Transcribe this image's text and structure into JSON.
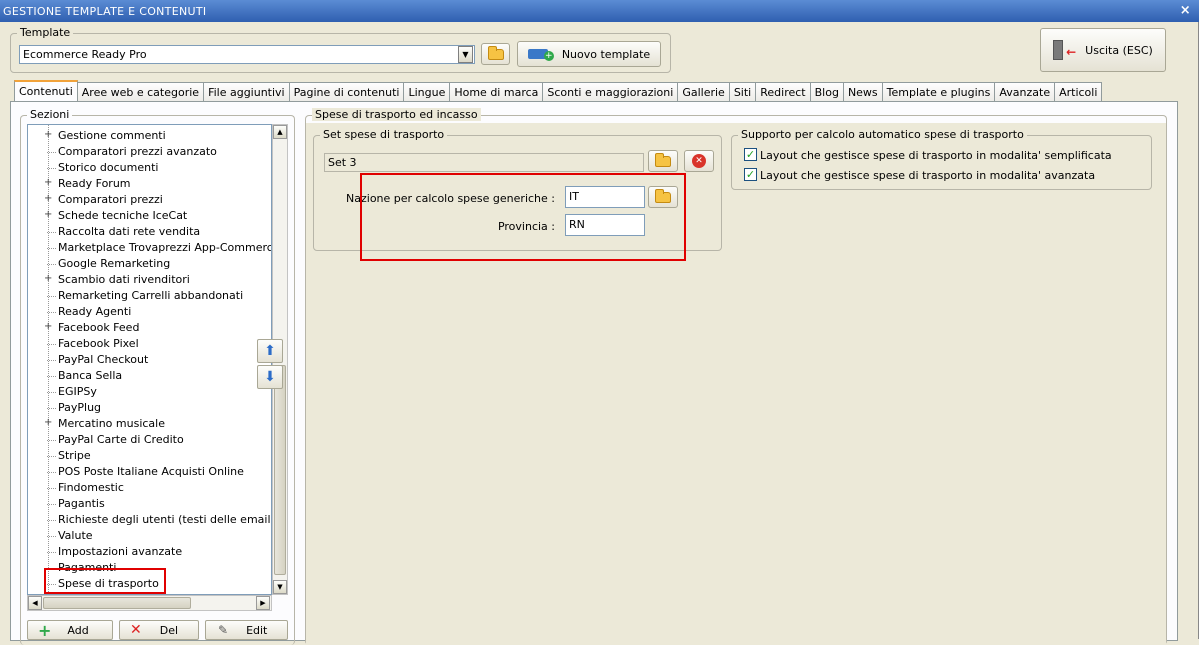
{
  "window": {
    "title": "GESTIONE TEMPLATE E CONTENUTI",
    "close_icon": "×"
  },
  "template_group": {
    "label": "Template",
    "selected": "Ecommerce Ready Pro",
    "new_button": "Nuovo template"
  },
  "exit_button": "Uscita (ESC)",
  "tabs": [
    {
      "label": "Contenuti",
      "active": true
    },
    {
      "label": "Aree web e categorie"
    },
    {
      "label": "File aggiuntivi"
    },
    {
      "label": "Pagine di contenuti"
    },
    {
      "label": "Lingue"
    },
    {
      "label": "Home di marca"
    },
    {
      "label": "Sconti e maggiorazioni"
    },
    {
      "label": "Gallerie"
    },
    {
      "label": "Siti"
    },
    {
      "label": "Redirect"
    },
    {
      "label": "Blog"
    },
    {
      "label": "News"
    },
    {
      "label": "Template e plugins"
    },
    {
      "label": "Avanzate"
    },
    {
      "label": "Articoli"
    }
  ],
  "sections": {
    "label": "Sezioni",
    "items": [
      {
        "label": "Gestione commenti",
        "expandable": true
      },
      {
        "label": "Comparatori prezzi avanzato",
        "expandable": false
      },
      {
        "label": "Storico documenti",
        "expandable": false
      },
      {
        "label": "Ready Forum",
        "expandable": true
      },
      {
        "label": "Comparatori prezzi",
        "expandable": true
      },
      {
        "label": "Schede tecniche IceCat",
        "expandable": true
      },
      {
        "label": "Raccolta dati rete vendita",
        "expandable": false
      },
      {
        "label": "Marketplace Trovaprezzi App-Commerce e Ki",
        "expandable": false
      },
      {
        "label": "Google Remarketing",
        "expandable": false
      },
      {
        "label": "Scambio dati rivenditori",
        "expandable": true
      },
      {
        "label": "Remarketing Carrelli abbandonati",
        "expandable": false
      },
      {
        "label": "Ready Agenti",
        "expandable": false
      },
      {
        "label": "Facebook Feed",
        "expandable": true
      },
      {
        "label": "Facebook Pixel",
        "expandable": false
      },
      {
        "label": "PayPal Checkout",
        "expandable": false
      },
      {
        "label": "Banca Sella",
        "expandable": false
      },
      {
        "label": "EGIPSy",
        "expandable": false
      },
      {
        "label": "PayPlug",
        "expandable": false
      },
      {
        "label": "Mercatino musicale",
        "expandable": true
      },
      {
        "label": "PayPal Carte di Credito",
        "expandable": false
      },
      {
        "label": "Stripe",
        "expandable": false
      },
      {
        "label": "POS Poste Italiane Acquisti Online",
        "expandable": false
      },
      {
        "label": "Findomestic",
        "expandable": false
      },
      {
        "label": "Pagantis",
        "expandable": false
      },
      {
        "label": "Richieste degli utenti (testi delle email)",
        "expandable": false
      },
      {
        "label": "Valute",
        "expandable": false
      },
      {
        "label": "Impostazioni avanzate",
        "expandable": false
      },
      {
        "label": "Pagamenti",
        "expandable": false
      },
      {
        "label": "Spese di trasporto",
        "expandable": false,
        "selected": true
      }
    ],
    "add_button": "Add",
    "del_button": "Del",
    "edit_button": "Edit"
  },
  "shipping": {
    "group_label": "Spese di trasporto ed incasso",
    "set_group_label": "Set spese di trasporto",
    "set_value": "Set 3",
    "nation_label": "Nazione per calcolo spese generiche :",
    "nation_value": "IT",
    "province_label": "Provincia :",
    "province_value": "RN",
    "auto_group_label": "Supporto per calcolo automatico spese di trasporto",
    "opt_simple": "Layout che gestisce spese di trasporto in modalita' semplificata",
    "opt_simple_checked": true,
    "opt_advanced": "Layout che gestisce spese di trasporto in modalita' avanzata",
    "opt_advanced_checked": true
  },
  "colors": {
    "highlight": "#e00000",
    "title_bar": "#2f5fb0",
    "tab_active_accent": "#f1a23a"
  }
}
